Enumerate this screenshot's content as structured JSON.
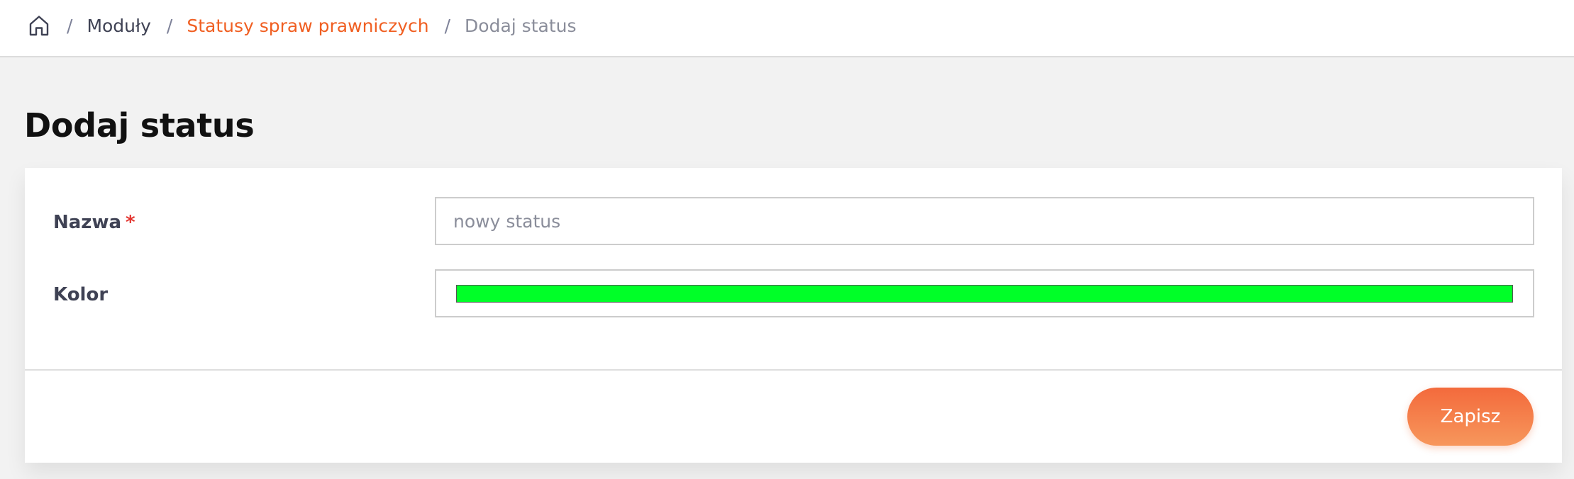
{
  "breadcrumb": {
    "home_icon": "home-icon",
    "separator": "/",
    "items": [
      {
        "label": "Moduły"
      },
      {
        "label": "Statusy spraw prawniczych"
      },
      {
        "label": "Dodaj status"
      }
    ]
  },
  "page": {
    "title": "Dodaj status"
  },
  "form": {
    "name": {
      "label": "Nazwa",
      "required_mark": "*",
      "value": "",
      "placeholder": "nowy status"
    },
    "color": {
      "label": "Kolor",
      "value": "#00ff28"
    }
  },
  "footer": {
    "save_label": "Zapisz"
  },
  "theme": {
    "accent": "#f05f22",
    "required": "#e3342f"
  }
}
